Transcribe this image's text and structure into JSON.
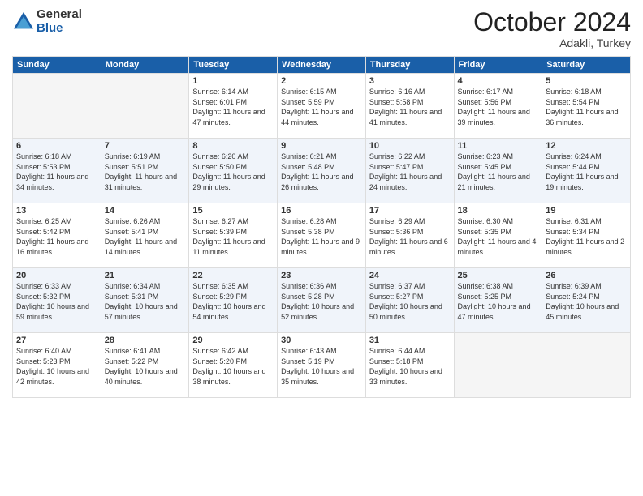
{
  "header": {
    "logo_general": "General",
    "logo_blue": "Blue",
    "month_title": "October 2024",
    "location": "Adakli, Turkey"
  },
  "days_of_week": [
    "Sunday",
    "Monday",
    "Tuesday",
    "Wednesday",
    "Thursday",
    "Friday",
    "Saturday"
  ],
  "weeks": [
    [
      {
        "day": "",
        "sunrise": "",
        "sunset": "",
        "daylight": ""
      },
      {
        "day": "",
        "sunrise": "",
        "sunset": "",
        "daylight": ""
      },
      {
        "day": "1",
        "sunrise": "Sunrise: 6:14 AM",
        "sunset": "Sunset: 6:01 PM",
        "daylight": "Daylight: 11 hours and 47 minutes."
      },
      {
        "day": "2",
        "sunrise": "Sunrise: 6:15 AM",
        "sunset": "Sunset: 5:59 PM",
        "daylight": "Daylight: 11 hours and 44 minutes."
      },
      {
        "day": "3",
        "sunrise": "Sunrise: 6:16 AM",
        "sunset": "Sunset: 5:58 PM",
        "daylight": "Daylight: 11 hours and 41 minutes."
      },
      {
        "day": "4",
        "sunrise": "Sunrise: 6:17 AM",
        "sunset": "Sunset: 5:56 PM",
        "daylight": "Daylight: 11 hours and 39 minutes."
      },
      {
        "day": "5",
        "sunrise": "Sunrise: 6:18 AM",
        "sunset": "Sunset: 5:54 PM",
        "daylight": "Daylight: 11 hours and 36 minutes."
      }
    ],
    [
      {
        "day": "6",
        "sunrise": "Sunrise: 6:18 AM",
        "sunset": "Sunset: 5:53 PM",
        "daylight": "Daylight: 11 hours and 34 minutes."
      },
      {
        "day": "7",
        "sunrise": "Sunrise: 6:19 AM",
        "sunset": "Sunset: 5:51 PM",
        "daylight": "Daylight: 11 hours and 31 minutes."
      },
      {
        "day": "8",
        "sunrise": "Sunrise: 6:20 AM",
        "sunset": "Sunset: 5:50 PM",
        "daylight": "Daylight: 11 hours and 29 minutes."
      },
      {
        "day": "9",
        "sunrise": "Sunrise: 6:21 AM",
        "sunset": "Sunset: 5:48 PM",
        "daylight": "Daylight: 11 hours and 26 minutes."
      },
      {
        "day": "10",
        "sunrise": "Sunrise: 6:22 AM",
        "sunset": "Sunset: 5:47 PM",
        "daylight": "Daylight: 11 hours and 24 minutes."
      },
      {
        "day": "11",
        "sunrise": "Sunrise: 6:23 AM",
        "sunset": "Sunset: 5:45 PM",
        "daylight": "Daylight: 11 hours and 21 minutes."
      },
      {
        "day": "12",
        "sunrise": "Sunrise: 6:24 AM",
        "sunset": "Sunset: 5:44 PM",
        "daylight": "Daylight: 11 hours and 19 minutes."
      }
    ],
    [
      {
        "day": "13",
        "sunrise": "Sunrise: 6:25 AM",
        "sunset": "Sunset: 5:42 PM",
        "daylight": "Daylight: 11 hours and 16 minutes."
      },
      {
        "day": "14",
        "sunrise": "Sunrise: 6:26 AM",
        "sunset": "Sunset: 5:41 PM",
        "daylight": "Daylight: 11 hours and 14 minutes."
      },
      {
        "day": "15",
        "sunrise": "Sunrise: 6:27 AM",
        "sunset": "Sunset: 5:39 PM",
        "daylight": "Daylight: 11 hours and 11 minutes."
      },
      {
        "day": "16",
        "sunrise": "Sunrise: 6:28 AM",
        "sunset": "Sunset: 5:38 PM",
        "daylight": "Daylight: 11 hours and 9 minutes."
      },
      {
        "day": "17",
        "sunrise": "Sunrise: 6:29 AM",
        "sunset": "Sunset: 5:36 PM",
        "daylight": "Daylight: 11 hours and 6 minutes."
      },
      {
        "day": "18",
        "sunrise": "Sunrise: 6:30 AM",
        "sunset": "Sunset: 5:35 PM",
        "daylight": "Daylight: 11 hours and 4 minutes."
      },
      {
        "day": "19",
        "sunrise": "Sunrise: 6:31 AM",
        "sunset": "Sunset: 5:34 PM",
        "daylight": "Daylight: 11 hours and 2 minutes."
      }
    ],
    [
      {
        "day": "20",
        "sunrise": "Sunrise: 6:33 AM",
        "sunset": "Sunset: 5:32 PM",
        "daylight": "Daylight: 10 hours and 59 minutes."
      },
      {
        "day": "21",
        "sunrise": "Sunrise: 6:34 AM",
        "sunset": "Sunset: 5:31 PM",
        "daylight": "Daylight: 10 hours and 57 minutes."
      },
      {
        "day": "22",
        "sunrise": "Sunrise: 6:35 AM",
        "sunset": "Sunset: 5:29 PM",
        "daylight": "Daylight: 10 hours and 54 minutes."
      },
      {
        "day": "23",
        "sunrise": "Sunrise: 6:36 AM",
        "sunset": "Sunset: 5:28 PM",
        "daylight": "Daylight: 10 hours and 52 minutes."
      },
      {
        "day": "24",
        "sunrise": "Sunrise: 6:37 AM",
        "sunset": "Sunset: 5:27 PM",
        "daylight": "Daylight: 10 hours and 50 minutes."
      },
      {
        "day": "25",
        "sunrise": "Sunrise: 6:38 AM",
        "sunset": "Sunset: 5:25 PM",
        "daylight": "Daylight: 10 hours and 47 minutes."
      },
      {
        "day": "26",
        "sunrise": "Sunrise: 6:39 AM",
        "sunset": "Sunset: 5:24 PM",
        "daylight": "Daylight: 10 hours and 45 minutes."
      }
    ],
    [
      {
        "day": "27",
        "sunrise": "Sunrise: 6:40 AM",
        "sunset": "Sunset: 5:23 PM",
        "daylight": "Daylight: 10 hours and 42 minutes."
      },
      {
        "day": "28",
        "sunrise": "Sunrise: 6:41 AM",
        "sunset": "Sunset: 5:22 PM",
        "daylight": "Daylight: 10 hours and 40 minutes."
      },
      {
        "day": "29",
        "sunrise": "Sunrise: 6:42 AM",
        "sunset": "Sunset: 5:20 PM",
        "daylight": "Daylight: 10 hours and 38 minutes."
      },
      {
        "day": "30",
        "sunrise": "Sunrise: 6:43 AM",
        "sunset": "Sunset: 5:19 PM",
        "daylight": "Daylight: 10 hours and 35 minutes."
      },
      {
        "day": "31",
        "sunrise": "Sunrise: 6:44 AM",
        "sunset": "Sunset: 5:18 PM",
        "daylight": "Daylight: 10 hours and 33 minutes."
      },
      {
        "day": "",
        "sunrise": "",
        "sunset": "",
        "daylight": ""
      },
      {
        "day": "",
        "sunrise": "",
        "sunset": "",
        "daylight": ""
      }
    ]
  ]
}
